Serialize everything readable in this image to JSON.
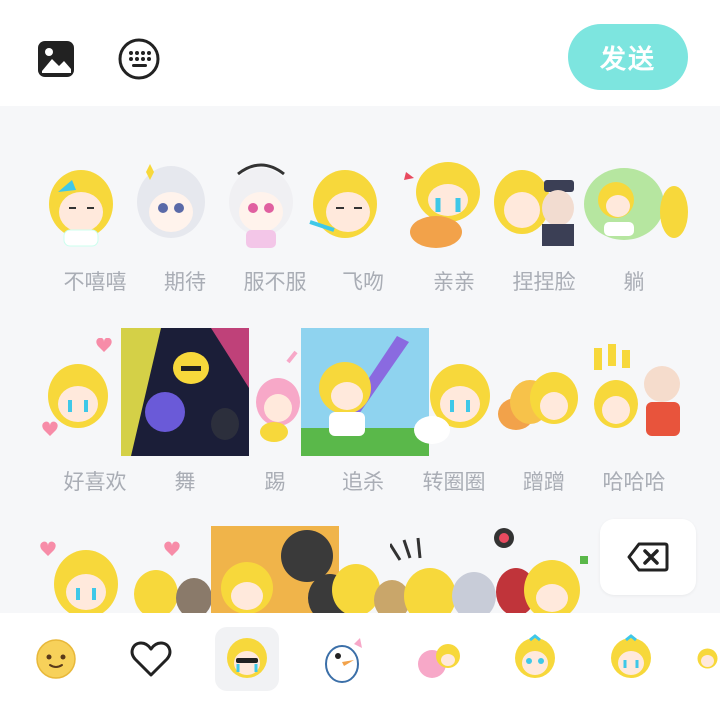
{
  "toolbar": {
    "send_label": "发送",
    "icons": [
      "image-icon",
      "keyboard-icon"
    ],
    "send_color": "#7de5df"
  },
  "stickers": {
    "row1": [
      "不嘻嘻",
      "期待",
      "服不服",
      "飞吻",
      "亲亲",
      "捏捏脸",
      "躺"
    ],
    "row2": [
      "好喜欢",
      "舞",
      "踢",
      "追杀",
      "转圈圈",
      "蹭蹭",
      "哈哈哈"
    ]
  },
  "delete_icon": "backspace-icon",
  "categories": [
    "emoji-icon",
    "heart-icon",
    "sticker-pack-1-icon",
    "duck-icon",
    "sticker-pack-3-icon",
    "sticker-pack-4-icon",
    "sticker-pack-5-icon",
    "sticker-pack-6-icon"
  ],
  "active_category": 2,
  "colors": {
    "label": "#a9adb5",
    "panel_bg": "#f6f7f9",
    "hair": "#f7d83b",
    "tears": "#3fc8e8"
  }
}
